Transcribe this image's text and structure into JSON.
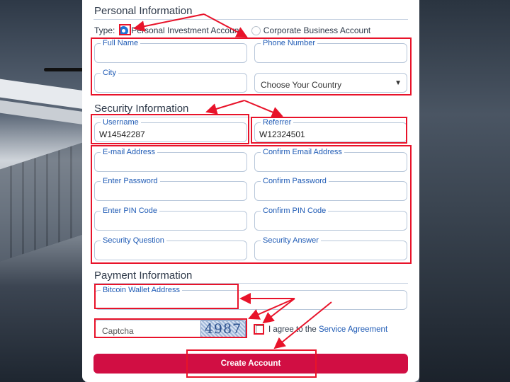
{
  "sections": {
    "personal": "Personal Information",
    "security": "Security Information",
    "payment": "Payment Information"
  },
  "type_row": {
    "label": "Type:",
    "options": [
      "Personal Investment Account",
      "Corporate Business Account"
    ],
    "selected": "Personal Investment Account"
  },
  "fields": {
    "full_name": "Full Name",
    "phone": "Phone Number",
    "city": "City",
    "country_select": "Choose Your Country",
    "username_label": "Username",
    "username_value": "W14542287",
    "referrer_label": "Referrer",
    "referrer_value": "W12324501",
    "email": "E-mail Address",
    "confirm_email": "Confirm Email Address",
    "password": "Enter Password",
    "confirm_password": "Confirm Password",
    "pin": "Enter PIN Code",
    "confirm_pin": "Confirm PIN Code",
    "security_question": "Security Question",
    "security_answer": "Security Answer",
    "bitcoin": "Bitcoin Wallet Address",
    "captcha_placeholder": "Captcha"
  },
  "captcha_text": "4987",
  "agreement": {
    "prefix": "I agree to the",
    "link": "Service Agreement",
    "checked": false
  },
  "create_button": "Create Account",
  "icons": {
    "select_chevron": "chevron-down-icon"
  },
  "colors": {
    "accent": "#1f5bb5",
    "button": "#d10e43",
    "annotation": "#e8132a"
  }
}
